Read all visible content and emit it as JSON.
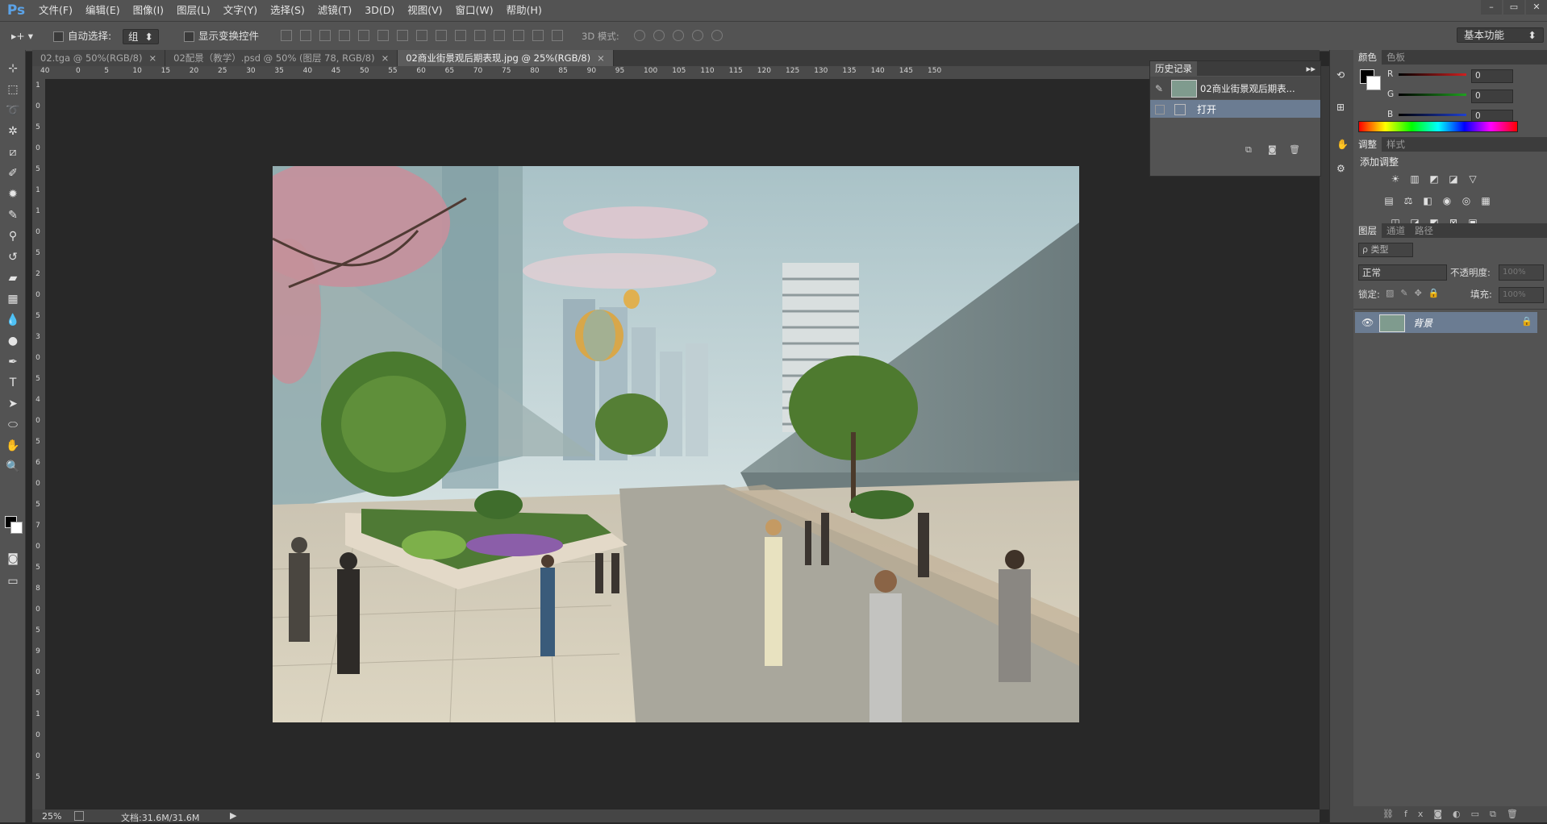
{
  "app": {
    "logo": "Ps"
  },
  "menu": [
    "文件(F)",
    "编辑(E)",
    "图像(I)",
    "图层(L)",
    "文字(Y)",
    "选择(S)",
    "滤镜(T)",
    "3D(D)",
    "视图(V)",
    "窗口(W)",
    "帮助(H)"
  ],
  "window_controls": [
    "–",
    "▭",
    "✕"
  ],
  "options": {
    "auto_select_label": "自动选择:",
    "auto_select_value": "组",
    "show_transform_label": "显示变换控件",
    "mode_3d_label": "3D 模式:",
    "workspace": "基本功能"
  },
  "tabs": [
    {
      "label": "02.tga @ 50%(RGB/8)",
      "close": "×",
      "active": false
    },
    {
      "label": "02配景（教学）.psd @ 50% (图层 78, RGB/8)",
      "close": "×",
      "active": false
    },
    {
      "label": "02商业街景观后期表现.jpg @ 25%(RGB/8)",
      "close": "×",
      "active": true
    }
  ],
  "ruler_top": [
    "0",
    "5",
    "10",
    "15",
    "20",
    "25",
    "30",
    "35",
    "40",
    "45",
    "50",
    "55",
    "60",
    "65",
    "70",
    "75",
    "80",
    "85",
    "90",
    "95",
    "100",
    "105",
    "110",
    "115",
    "120",
    "125",
    "130",
    "135",
    "140",
    "145",
    "150"
  ],
  "ruler_top_first": "40",
  "ruler_left": [
    "1",
    "0",
    "5",
    "0",
    "5",
    "1",
    "1",
    "0",
    "5",
    "2",
    "0",
    "5",
    "3",
    "0",
    "5",
    "4",
    "0",
    "5",
    "6",
    "0",
    "5",
    "7",
    "0",
    "5",
    "8",
    "0",
    "5",
    "9",
    "0",
    "5",
    "1",
    "0",
    "0",
    "5"
  ],
  "status": {
    "zoom": "25%",
    "doc": "文档:31.6M/31.6M"
  },
  "history": {
    "tabs": [
      "历史记录"
    ],
    "snapshot_label": "02商业街景观后期表...",
    "item_label": "打开"
  },
  "color_panel": {
    "tabs": [
      "颜色",
      "色板"
    ],
    "channels": [
      {
        "name": "R",
        "value": "0",
        "color": "#d02020"
      },
      {
        "name": "G",
        "value": "0",
        "color": "#20a020"
      },
      {
        "name": "B",
        "value": "0",
        "color": "#2040d0"
      }
    ]
  },
  "adjust_panel": {
    "tabs": [
      "调整",
      "样式"
    ],
    "title": "添加调整"
  },
  "layers_panel": {
    "tabs": [
      "图层",
      "通道",
      "路径"
    ],
    "kind_filter": "ρ 类型",
    "blend_mode": "正常",
    "opacity_label": "不透明度:",
    "opacity_value": "100%",
    "lock_label": "锁定:",
    "fill_label": "填充:",
    "fill_value": "100%",
    "layers": [
      {
        "name": "背景",
        "visible": true,
        "locked": true
      }
    ]
  }
}
